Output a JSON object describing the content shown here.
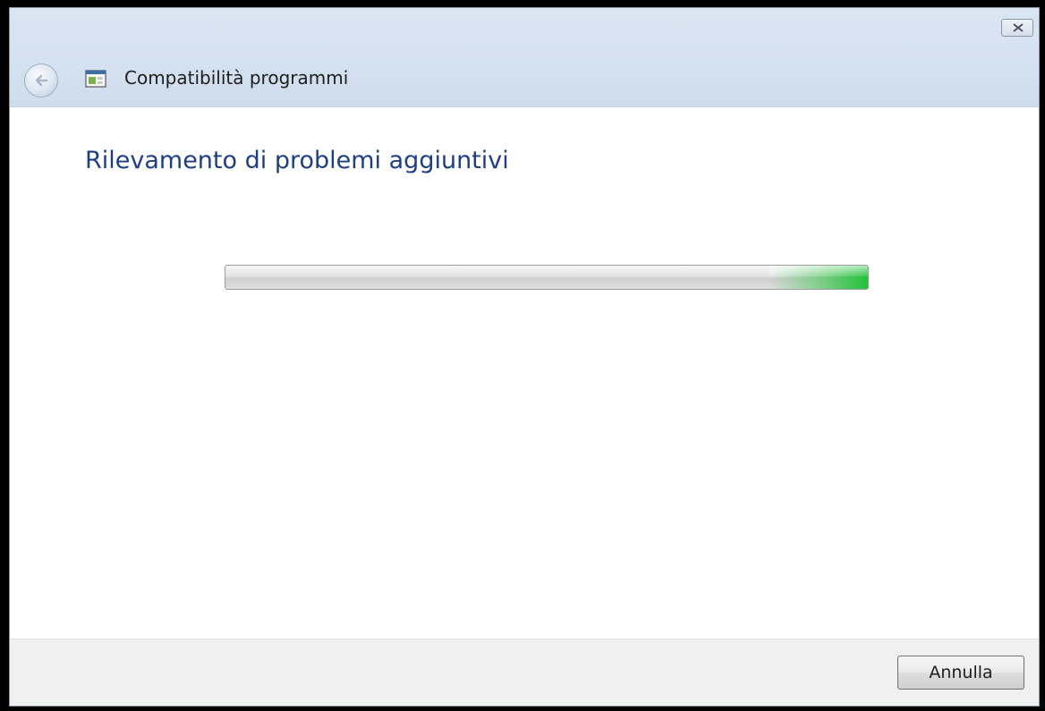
{
  "window": {
    "title": "Compatibilità programmi"
  },
  "content": {
    "heading": "Rilevamento di problemi aggiuntivi",
    "progress": {
      "style": "marquee",
      "accent_color": "#22c23a"
    }
  },
  "footer": {
    "cancel_label": "Annulla"
  },
  "icons": {
    "close": "close-icon",
    "back": "back-arrow-icon",
    "app": "program-compatibility-icon"
  },
  "colors": {
    "heading": "#1e3f86",
    "titlebar": "#d4e1f0"
  }
}
